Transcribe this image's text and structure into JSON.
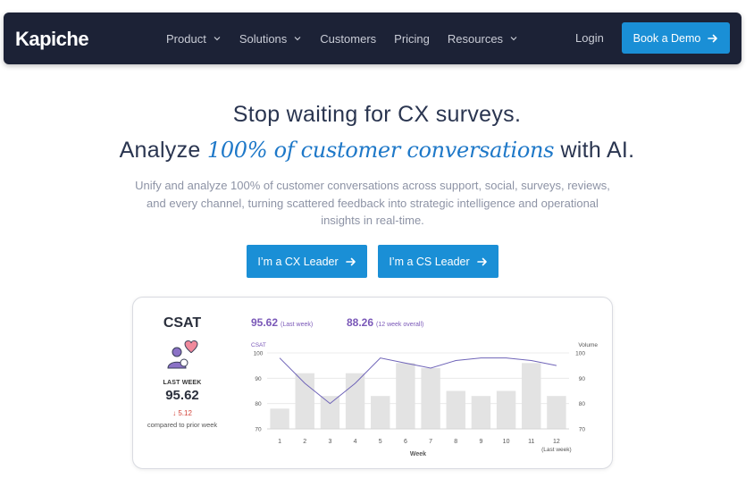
{
  "nav": {
    "logo": "Kapiche",
    "items": [
      {
        "label": "Product",
        "dropdown": true
      },
      {
        "label": "Solutions",
        "dropdown": true
      },
      {
        "label": "Customers",
        "dropdown": false
      },
      {
        "label": "Pricing",
        "dropdown": false
      },
      {
        "label": "Resources",
        "dropdown": true
      }
    ],
    "login": "Login",
    "demo_label": "Book a Demo"
  },
  "hero": {
    "title_line1": "Stop waiting for CX surveys.",
    "title_line2_prefix": "Analyze",
    "title_line2_script": "100% of customer conversations",
    "title_line2_suffix": "with AI.",
    "subtitle": "Unify and analyze 100% of customer conversations across support, social, surveys, reviews, and every channel, turning scattered feedback into strategic intelligence and operational insights in real-time.",
    "cta_cx": "I’m a CX Leader",
    "cta_cs": "I’m a CS Leader"
  },
  "colors": {
    "nav_bg": "#1c2236",
    "accent": "#1a8fd6",
    "kpi_purple": "#7a58b8",
    "delta_red": "#d2443a",
    "bar_gray": "#e3e3e3",
    "line_color": "#6f64b8"
  },
  "csat_card": {
    "title": "CSAT",
    "icon": "person-heart-icon",
    "last_week_label": "LAST WEEK",
    "last_week_value": "95.62",
    "delta": "5.12",
    "delta_direction": "down",
    "compare_text": "compared to prior week",
    "kpi_last_week": "95.62",
    "kpi_last_week_note": "(Last week)",
    "kpi_overall": "88.26",
    "kpi_overall_note": "(12 week overall)"
  },
  "chart_data": {
    "type": "bar+line",
    "x_label": "Week",
    "x_note": "(Last week)",
    "left_axis_label": "CSAT",
    "right_axis_label": "Volume",
    "categories": [
      "1",
      "2",
      "3",
      "4",
      "5",
      "6",
      "7",
      "8",
      "9",
      "10",
      "11",
      "12"
    ],
    "left_ticks": [
      "100",
      "90",
      "80",
      "70"
    ],
    "right_ticks": [
      "100",
      "90",
      "80",
      "70"
    ],
    "ylim": [
      70,
      100
    ],
    "series": [
      {
        "type": "bar",
        "values": [
          78,
          92,
          83,
          92,
          83,
          96,
          94,
          85,
          83,
          85,
          96,
          83
        ]
      },
      {
        "type": "line",
        "values": [
          98,
          88,
          80,
          88,
          98,
          96,
          94,
          97,
          98,
          98,
          97,
          95
        ]
      }
    ]
  }
}
